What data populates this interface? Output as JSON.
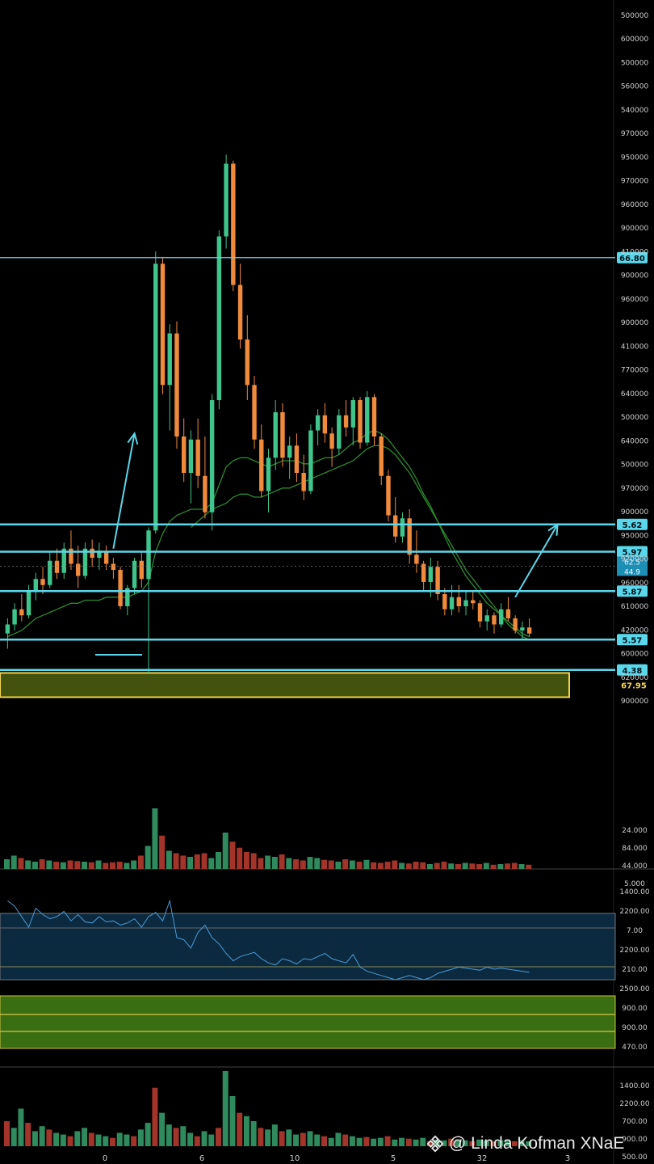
{
  "watermark": {
    "text": "@ Linda Kofman XNaE",
    "icon": "binance-logo-icon"
  },
  "colors": {
    "background": "#000000",
    "up": "#3fc58c",
    "down": "#f08a3c",
    "level_line": "#5ad7ea",
    "band_fill": "#5a6e10",
    "band_border": "#f2d34a",
    "rsi_fill": "#0b2a40",
    "oscillator_fill": "#3a6e12",
    "ma": "#2d8a2d",
    "axis_text": "#cfcfcf"
  },
  "chart_data": [
    {
      "type": "candlestick",
      "name": "price",
      "y_axis_labels": [
        "500000",
        "600000",
        "500000",
        "560000",
        "540000",
        "970000",
        "950000",
        "970000",
        "960000",
        "900000",
        "410000",
        "900000",
        "960000",
        "900000",
        "410000",
        "770000",
        "640000",
        "500000",
        "640000",
        "500000",
        "970000",
        "900000",
        "950000",
        "920000",
        "960000",
        "610000",
        "420000",
        "600000",
        "620000",
        "900000"
      ],
      "levels": [
        {
          "label": "66.80",
          "value": 101.5
        },
        {
          "label": "5.62",
          "value": 57.5
        },
        {
          "label": "5.97",
          "value": 53.0
        },
        {
          "label": "5.87",
          "value": 46.5
        },
        {
          "label": "5.57",
          "value": 38.5
        },
        {
          "label": "4.38",
          "value": 33.5
        }
      ],
      "current_price_labels": [
        "62.5",
        "44.9"
      ],
      "zone": {
        "label": "67.95",
        "from": 29.0,
        "to": 33.0
      },
      "trend_arrows": [
        {
          "from": {
            "index": 15,
            "price": 53.5
          },
          "to": {
            "index": 18,
            "price": 72.5
          }
        },
        {
          "from": {
            "index": 72,
            "price": 45.5
          },
          "to": {
            "index": 78,
            "price": 57.5
          }
        }
      ],
      "candles": [
        {
          "o": 39.5,
          "h": 42.0,
          "l": 37.0,
          "c": 41.0
        },
        {
          "o": 41.0,
          "h": 44.5,
          "l": 40.0,
          "c": 43.5
        },
        {
          "o": 43.5,
          "h": 46.0,
          "l": 41.5,
          "c": 42.5
        },
        {
          "o": 42.5,
          "h": 47.5,
          "l": 42.0,
          "c": 46.5
        },
        {
          "o": 46.5,
          "h": 49.5,
          "l": 45.0,
          "c": 48.5
        },
        {
          "o": 48.5,
          "h": 50.5,
          "l": 46.0,
          "c": 47.5
        },
        {
          "o": 47.5,
          "h": 53.0,
          "l": 47.0,
          "c": 51.5
        },
        {
          "o": 51.5,
          "h": 53.5,
          "l": 48.5,
          "c": 49.5
        },
        {
          "o": 49.5,
          "h": 54.5,
          "l": 48.5,
          "c": 53.5
        },
        {
          "o": 53.5,
          "h": 56.5,
          "l": 50.0,
          "c": 51.0
        },
        {
          "o": 51.0,
          "h": 54.0,
          "l": 47.0,
          "c": 49.0
        },
        {
          "o": 49.0,
          "h": 54.5,
          "l": 48.5,
          "c": 53.5
        },
        {
          "o": 53.5,
          "h": 55.0,
          "l": 50.5,
          "c": 52.0
        },
        {
          "o": 52.0,
          "h": 54.5,
          "l": 50.0,
          "c": 53.0
        },
        {
          "o": 53.0,
          "h": 54.0,
          "l": 50.0,
          "c": 51.0
        },
        {
          "o": 51.0,
          "h": 52.0,
          "l": 48.5,
          "c": 50.0
        },
        {
          "o": 50.0,
          "h": 50.5,
          "l": 43.5,
          "c": 44.0
        },
        {
          "o": 44.0,
          "h": 47.5,
          "l": 42.5,
          "c": 47.0
        },
        {
          "o": 47.0,
          "h": 52.0,
          "l": 46.0,
          "c": 51.5
        },
        {
          "o": 51.5,
          "h": 53.0,
          "l": 47.0,
          "c": 48.5
        },
        {
          "o": 48.5,
          "h": 57.0,
          "l": 33.0,
          "c": 56.5
        },
        {
          "o": 56.5,
          "h": 102.5,
          "l": 56.0,
          "c": 100.5
        },
        {
          "o": 100.5,
          "h": 101.5,
          "l": 79.0,
          "c": 80.5
        },
        {
          "o": 80.5,
          "h": 90.5,
          "l": 73.0,
          "c": 89.0
        },
        {
          "o": 89.0,
          "h": 91.0,
          "l": 70.0,
          "c": 72.0
        },
        {
          "o": 72.0,
          "h": 75.0,
          "l": 64.5,
          "c": 66.0
        },
        {
          "o": 66.0,
          "h": 73.0,
          "l": 61.0,
          "c": 71.5
        },
        {
          "o": 71.5,
          "h": 75.0,
          "l": 63.5,
          "c": 65.5
        },
        {
          "o": 65.5,
          "h": 72.0,
          "l": 58.5,
          "c": 59.5
        },
        {
          "o": 59.5,
          "h": 79.0,
          "l": 56.5,
          "c": 78.0
        },
        {
          "o": 78.0,
          "h": 106.0,
          "l": 76.5,
          "c": 105.0
        },
        {
          "o": 105.0,
          "h": 118.5,
          "l": 103.0,
          "c": 117.0
        },
        {
          "o": 117.0,
          "h": 117.5,
          "l": 96.0,
          "c": 97.0
        },
        {
          "o": 97.0,
          "h": 100.5,
          "l": 86.5,
          "c": 88.0
        },
        {
          "o": 88.0,
          "h": 92.0,
          "l": 78.0,
          "c": 80.5
        },
        {
          "o": 80.5,
          "h": 82.0,
          "l": 70.0,
          "c": 71.5
        },
        {
          "o": 71.5,
          "h": 74.0,
          "l": 62.0,
          "c": 63.0
        },
        {
          "o": 63.0,
          "h": 70.0,
          "l": 59.5,
          "c": 68.5
        },
        {
          "o": 68.5,
          "h": 78.0,
          "l": 66.5,
          "c": 76.0
        },
        {
          "o": 76.0,
          "h": 77.5,
          "l": 67.0,
          "c": 68.5
        },
        {
          "o": 68.5,
          "h": 72.0,
          "l": 65.0,
          "c": 70.5
        },
        {
          "o": 70.5,
          "h": 72.5,
          "l": 64.5,
          "c": 66.0
        },
        {
          "o": 66.0,
          "h": 69.0,
          "l": 61.5,
          "c": 63.0
        },
        {
          "o": 63.0,
          "h": 74.0,
          "l": 62.5,
          "c": 73.0
        },
        {
          "o": 73.0,
          "h": 76.5,
          "l": 70.5,
          "c": 75.5
        },
        {
          "o": 75.5,
          "h": 77.5,
          "l": 71.0,
          "c": 72.5
        },
        {
          "o": 72.5,
          "h": 73.5,
          "l": 67.0,
          "c": 70.0
        },
        {
          "o": 70.0,
          "h": 76.5,
          "l": 69.0,
          "c": 75.5
        },
        {
          "o": 75.5,
          "h": 78.0,
          "l": 72.0,
          "c": 73.5
        },
        {
          "o": 73.5,
          "h": 78.5,
          "l": 70.5,
          "c": 78.0
        },
        {
          "o": 78.0,
          "h": 78.5,
          "l": 70.0,
          "c": 71.0
        },
        {
          "o": 71.0,
          "h": 79.5,
          "l": 70.5,
          "c": 78.5
        },
        {
          "o": 78.5,
          "h": 79.0,
          "l": 70.5,
          "c": 72.0
        },
        {
          "o": 72.0,
          "h": 72.5,
          "l": 64.0,
          "c": 65.5
        },
        {
          "o": 65.5,
          "h": 66.5,
          "l": 58.0,
          "c": 59.0
        },
        {
          "o": 59.0,
          "h": 62.0,
          "l": 54.5,
          "c": 55.5
        },
        {
          "o": 55.5,
          "h": 59.5,
          "l": 54.5,
          "c": 58.5
        },
        {
          "o": 58.5,
          "h": 60.0,
          "l": 51.0,
          "c": 52.5
        },
        {
          "o": 52.5,
          "h": 56.5,
          "l": 49.5,
          "c": 51.0
        },
        {
          "o": 51.0,
          "h": 51.5,
          "l": 46.5,
          "c": 48.0
        },
        {
          "o": 48.0,
          "h": 52.0,
          "l": 45.5,
          "c": 50.5
        },
        {
          "o": 50.5,
          "h": 51.5,
          "l": 45.0,
          "c": 46.0
        },
        {
          "o": 46.0,
          "h": 47.0,
          "l": 42.5,
          "c": 43.5
        },
        {
          "o": 43.5,
          "h": 47.5,
          "l": 42.5,
          "c": 45.5
        },
        {
          "o": 45.5,
          "h": 47.5,
          "l": 43.0,
          "c": 44.0
        },
        {
          "o": 44.0,
          "h": 46.5,
          "l": 42.5,
          "c": 45.0
        },
        {
          "o": 45.0,
          "h": 46.5,
          "l": 43.5,
          "c": 44.5
        },
        {
          "o": 44.5,
          "h": 45.0,
          "l": 40.5,
          "c": 41.5
        },
        {
          "o": 41.5,
          "h": 43.5,
          "l": 40.0,
          "c": 42.5
        },
        {
          "o": 42.5,
          "h": 43.0,
          "l": 39.5,
          "c": 41.0
        },
        {
          "o": 41.0,
          "h": 44.5,
          "l": 40.5,
          "c": 43.5
        },
        {
          "o": 43.5,
          "h": 45.5,
          "l": 41.5,
          "c": 42.0
        },
        {
          "o": 42.0,
          "h": 42.5,
          "l": 39.5,
          "c": 40.0
        },
        {
          "o": 40.0,
          "h": 41.5,
          "l": 38.5,
          "c": 40.5
        },
        {
          "o": 40.5,
          "h": 42.0,
          "l": 39.0,
          "c": 39.5
        }
      ],
      "moving_averages": [
        {
          "name": "",
          "values": [
            39.0,
            39.5,
            40.0,
            41.0,
            42.0,
            42.5,
            43.0,
            43.5,
            44.0,
            44.5,
            44.5,
            45.0,
            45.0,
            45.0,
            45.5,
            45.5,
            45.5,
            45.5,
            46.0,
            46.5,
            48.0,
            53.0,
            56.0,
            58.0,
            59.0,
            59.5,
            60.0,
            60.0,
            60.0,
            61.0,
            64.0,
            67.0,
            68.0,
            68.5,
            68.5,
            68.0,
            67.5,
            67.0,
            67.5,
            68.0,
            68.0,
            68.0,
            67.5,
            67.5,
            68.0,
            68.5,
            68.5,
            69.0,
            70.0,
            71.0,
            71.5,
            72.5,
            73.0,
            72.5,
            71.5,
            70.0,
            68.5,
            67.0,
            65.0,
            62.5,
            60.5,
            58.0,
            55.5,
            53.0,
            51.0,
            49.0,
            47.5,
            46.0,
            44.5,
            43.5,
            42.5,
            41.5,
            40.5,
            39.5,
            39.0
          ]
        },
        {
          "name": "",
          "values": [
            null,
            null,
            null,
            null,
            null,
            null,
            null,
            null,
            null,
            null,
            null,
            null,
            null,
            null,
            null,
            null,
            null,
            null,
            null,
            null,
            null,
            null,
            null,
            null,
            null,
            null,
            57.0,
            58.0,
            59.0,
            60.0,
            60.5,
            61.0,
            62.0,
            62.5,
            62.5,
            62.0,
            62.0,
            62.5,
            63.0,
            63.5,
            63.5,
            64.0,
            64.5,
            65.0,
            65.5,
            66.0,
            66.5,
            67.0,
            67.5,
            68.0,
            69.0,
            70.0,
            70.5,
            70.5,
            70.0,
            69.0,
            67.5,
            66.0,
            64.0,
            62.0,
            60.0,
            58.0,
            56.0,
            54.0,
            52.0,
            50.0,
            48.5,
            47.0,
            45.5,
            44.0,
            42.5,
            41.0,
            40.0,
            39.0,
            38.5
          ]
        }
      ]
    },
    {
      "type": "bar",
      "name": "volume",
      "y_axis_labels": [
        "24.000",
        "84.000",
        "44.000",
        "5.000"
      ],
      "values": [
        16,
        22,
        18,
        14,
        12,
        16,
        14,
        12,
        11,
        14,
        13,
        12,
        11,
        14,
        10,
        11,
        12,
        10,
        14,
        22,
        38,
        100,
        55,
        30,
        26,
        22,
        20,
        24,
        26,
        18,
        28,
        60,
        45,
        35,
        28,
        26,
        18,
        22,
        20,
        24,
        18,
        16,
        14,
        20,
        18,
        15,
        14,
        12,
        16,
        14,
        12,
        15,
        11,
        10,
        12,
        14,
        10,
        9,
        12,
        11,
        8,
        10,
        12,
        9,
        8,
        10,
        9,
        8,
        10,
        7,
        8,
        9,
        10,
        8,
        7
      ]
    },
    {
      "type": "line",
      "name": "oscillator",
      "y_axis_labels": [
        "1400.00",
        "2200.00",
        "7.00",
        "2200.00",
        "210.00",
        "2500.00",
        "900.00",
        "900.00",
        "470.00"
      ],
      "values": [
        85,
        80,
        70,
        60,
        78,
        72,
        68,
        70,
        75,
        66,
        72,
        65,
        64,
        70,
        65,
        66,
        62,
        64,
        68,
        60,
        70,
        74,
        66,
        85,
        50,
        48,
        40,
        55,
        62,
        50,
        44,
        35,
        28,
        32,
        34,
        36,
        30,
        26,
        24,
        30,
        28,
        25,
        30,
        29,
        32,
        35,
        30,
        28,
        26,
        34,
        22,
        18,
        16,
        14,
        12,
        10,
        12,
        14,
        12,
        10,
        12,
        16,
        18,
        20,
        22,
        21,
        20,
        19,
        22,
        20,
        21,
        20,
        19,
        18,
        17
      ],
      "band_levels": [
        75,
        15
      ],
      "oscillator_levels": [
        -40,
        -60,
        -80
      ]
    },
    {
      "type": "bar",
      "name": "volume_2",
      "y_axis_labels": [
        "1400.00",
        "2200.00",
        "700.00",
        "900.00",
        "500.00"
      ],
      "values": [
        30,
        22,
        45,
        28,
        18,
        24,
        20,
        16,
        14,
        12,
        18,
        22,
        16,
        14,
        12,
        10,
        16,
        14,
        12,
        20,
        28,
        70,
        40,
        26,
        22,
        24,
        16,
        12,
        18,
        14,
        22,
        90,
        60,
        40,
        36,
        30,
        22,
        20,
        26,
        18,
        20,
        14,
        16,
        18,
        14,
        12,
        10,
        16,
        14,
        12,
        10,
        11,
        9,
        10,
        12,
        8,
        10,
        9,
        8,
        10,
        6,
        8,
        7,
        9,
        8,
        7,
        6,
        8,
        7,
        6,
        7,
        8,
        6,
        7,
        6
      ],
      "time_labels": [
        "0",
        "6",
        "10",
        "5",
        "32",
        "3"
      ]
    }
  ]
}
